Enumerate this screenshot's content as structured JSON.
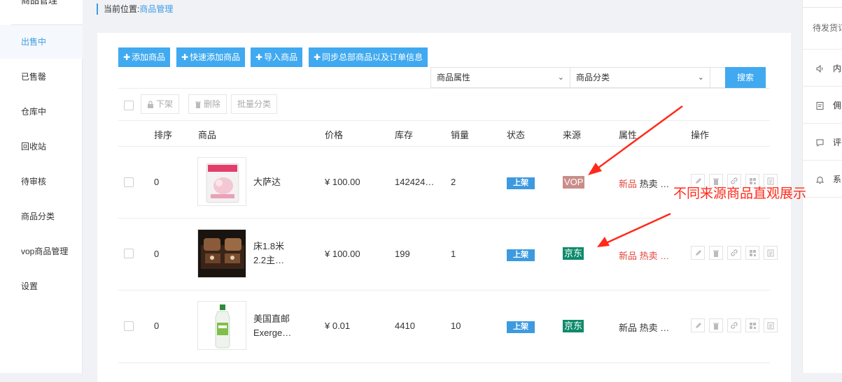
{
  "sidebar": {
    "header": "商品管理",
    "items": [
      {
        "label": "出售中",
        "active": true
      },
      {
        "label": "已售罄"
      },
      {
        "label": "仓库中"
      },
      {
        "label": "回收站"
      },
      {
        "label": "待审核"
      },
      {
        "label": "商品分类"
      },
      {
        "label": "vop商品管理"
      },
      {
        "label": "设置"
      }
    ]
  },
  "breadcrumb": {
    "prefix": "当前位置:",
    "current": "商品管理"
  },
  "toolbar": {
    "add": "添加商品",
    "quick_add": "快速添加商品",
    "import": "导入商品",
    "sync": "同步总部商品以及订单信息",
    "plus": "✚"
  },
  "filters": {
    "attribute": "商品属性",
    "category": "商品分类",
    "search": "搜索"
  },
  "bulk": {
    "off_shelf": "下架",
    "delete": "删除",
    "batch_category": "批量分类"
  },
  "table": {
    "headers": [
      "排序",
      "商品",
      "价格",
      "库存",
      "销量",
      "状态",
      "来源",
      "属性",
      "操作"
    ],
    "rows": [
      {
        "sort": "0",
        "name": "大萨达",
        "price": "¥ 100.00",
        "stock": "142424…",
        "sales": "2",
        "status": "上架",
        "source": "VOP",
        "source_color": "#c98d8a",
        "attr_new": "新品",
        "attr_rest": "热卖 …",
        "attr_new_color": "#e0463c",
        "attr_rest_color": "#e0463c"
      },
      {
        "sort": "0",
        "name": "床1.8米2.2主…",
        "name_line1": "床1.8米",
        "name_line2": "2.2主…",
        "price": "¥ 100.00",
        "stock": "199",
        "sales": "1",
        "status": "上架",
        "source": "京东",
        "source_color": "#0e8a6b",
        "attr_new": "新品",
        "attr_rest": "热卖 …",
        "attr_new_color": "#e0463c",
        "attr_rest_color": "#e0463c"
      },
      {
        "sort": "0",
        "name_line1": "美国直邮",
        "name_line2": "Exerge…",
        "price": "¥ 0.01",
        "stock": "4410",
        "sales": "10",
        "status": "上架",
        "source": "京东",
        "source_color": "#0e8a6b",
        "attr_new": "新品",
        "attr_rest": "热卖 …",
        "attr_new_color": "#333333",
        "attr_rest_color": "#333333"
      }
    ]
  },
  "right_panel": {
    "title": "待发货订",
    "items": [
      {
        "label": "内",
        "icon": "speaker-icon"
      },
      {
        "label": "佣",
        "icon": "receipt-icon"
      },
      {
        "label": "评",
        "icon": "comment-icon"
      },
      {
        "label": "系",
        "icon": "bell-icon"
      }
    ]
  },
  "annotation": {
    "text": "不同来源商品直观展示",
    "color": "#ff2a1a"
  },
  "colors": {
    "accent": "#40a9f0",
    "status_badge": "#3d9ae0"
  }
}
